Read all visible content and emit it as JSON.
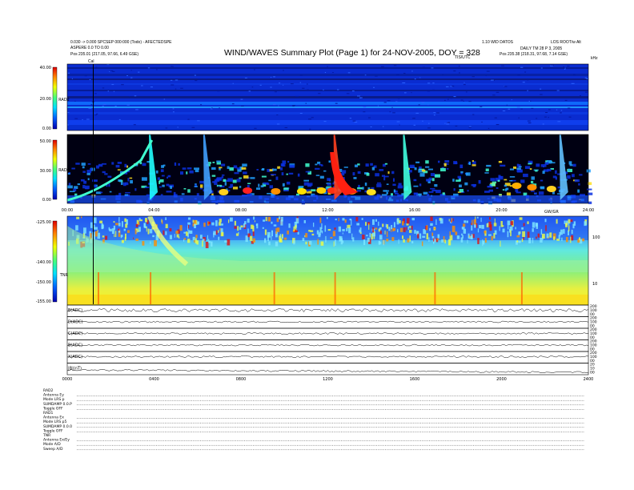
{
  "header": {
    "title": "WIND/WAVES Summary Plot (Page 1) for 24-NOV-2005, DOY = 328",
    "left_line1": "0.030 -> 0.000 SPCSEP 000:000 (Todo) - AFECTEDSPE",
    "left_line2": "ASPERE 0.0 TO 0.00",
    "left_line3": "Pos   235.01 (217.05, 97.66, 6.49 GSE)",
    "right_line1": "1.10 WID DATOS",
    "right_line2": "LOS ROOT/w Alt",
    "right_line3": "DAILY TM 28 P 3, 2005",
    "right_line4": "Pos   235.38 (218.31, 97.68, 7.14 GSE)",
    "cal_label": "Cal",
    "mid_label": "TIS/UTC",
    "khz_label": "kHz"
  },
  "chart_data": [
    {
      "type": "heatmap",
      "name": "RAD2",
      "ylabel": "RAD2",
      "ylim": [
        0,
        40
      ],
      "yticks": [
        "40.00",
        "20.00",
        "0.00"
      ],
      "colorbar": "blue-cyan-green-yellow-red"
    },
    {
      "type": "heatmap",
      "name": "RAD1",
      "ylabel": "RAD1",
      "ylim": [
        0,
        50
      ],
      "yticks": [
        "50.00",
        "30.00",
        "0.00"
      ],
      "xticks": [
        "00:00",
        "04:00",
        "08:00",
        "12:00",
        "16:00",
        "20:00",
        "24:00"
      ],
      "x_end_label": "GW/GR"
    },
    {
      "type": "heatmap",
      "name": "TNR",
      "ylabel": "TNR",
      "ylim": [
        -155,
        -125
      ],
      "yticks": [
        "-125.00",
        "-140.00",
        "-150.00",
        "-155.00"
      ],
      "right_ticks": [
        "100",
        "10"
      ],
      "events_hours": [
        1.4,
        3.8,
        9.5,
        12.3,
        16.9,
        20.9
      ]
    },
    {
      "type": "line",
      "panels": [
        {
          "label": "B(ADC)",
          "right_ticks": [
            "200",
            "100",
            "00"
          ]
        },
        {
          "label": "D(ADC)",
          "right_ticks": [
            "200",
            "100",
            "00"
          ]
        },
        {
          "label": "C(ADC)",
          "right_ticks": [
            "200",
            "100",
            "00"
          ]
        },
        {
          "label": "B(ADC)",
          "right_ticks": [
            "200",
            "100",
            "00"
          ]
        },
        {
          "label": "X(ADC)",
          "right_ticks": [
            "200",
            "100",
            "00"
          ]
        },
        {
          "label": "|B|(nT)",
          "right_ticks": [
            "20",
            "10",
            "00"
          ]
        }
      ],
      "xticks": [
        "0000",
        "0400",
        "0800",
        "1200",
        "1600",
        "2000",
        "2400"
      ]
    }
  ],
  "footer_table": {
    "sections": [
      {
        "head": "RAD2",
        "rows": [
          "Antenna   Ey",
          "Mode  LRS p",
          "SUMDAMP  0.0.P",
          "Toggle    OFF"
        ]
      },
      {
        "head": "RAD1",
        "rows": [
          "Antenna   Ex",
          "Mode  LRS p5",
          "SUMDAMP  0.0.0",
          "Toggle    OFF"
        ]
      },
      {
        "head": "TNR",
        "rows": [
          "Antenna   Ex/Ey",
          "Mode  A/D",
          "Sweep   A/D"
        ]
      }
    ]
  }
}
